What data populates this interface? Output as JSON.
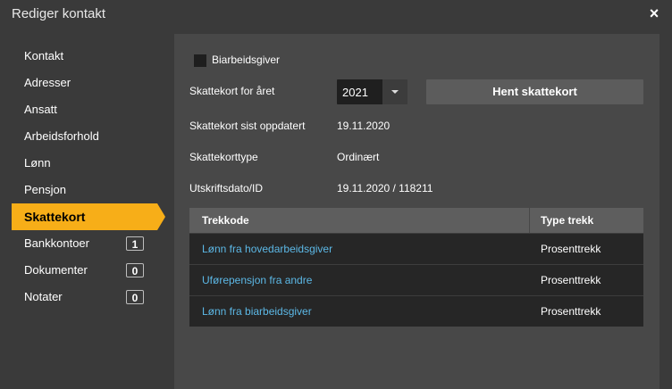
{
  "window": {
    "title": "Rediger kontakt",
    "close_label": "×"
  },
  "sidebar": {
    "items": [
      {
        "label": "Kontakt"
      },
      {
        "label": "Adresser"
      },
      {
        "label": "Ansatt"
      },
      {
        "label": "Arbeidsforhold"
      },
      {
        "label": "Lønn"
      },
      {
        "label": "Pensjon"
      },
      {
        "label": "Skattekort",
        "active": true
      },
      {
        "label": "Bankkontoer",
        "badge": "1"
      },
      {
        "label": "Dokumenter",
        "badge": "0"
      },
      {
        "label": "Notater",
        "badge": "0"
      }
    ]
  },
  "form": {
    "secondary_employer_label": "Biarbeidsgiver",
    "year_label": "Skattekort for året",
    "year_value": "2021",
    "fetch_button": "Hent skattekort",
    "updated_label": "Skattekort sist oppdatert",
    "updated_value": "19.11.2020",
    "type_label": "Skattekorttype",
    "type_value": "Ordinært",
    "printdate_label": "Utskriftsdato/ID",
    "printdate_value": "19.11.2020 / 118211"
  },
  "table": {
    "headers": [
      "Trekkode",
      "Type trekk"
    ],
    "rows": [
      [
        "Lønn fra hovedarbeidsgiver",
        "Prosenttrekk"
      ],
      [
        "Uførepensjon fra andre",
        "Prosenttrekk"
      ],
      [
        "Lønn fra biarbeidsgiver",
        "Prosenttrekk"
      ]
    ]
  },
  "colors": {
    "accent": "#f7ae18",
    "link": "#5cb8e6"
  }
}
